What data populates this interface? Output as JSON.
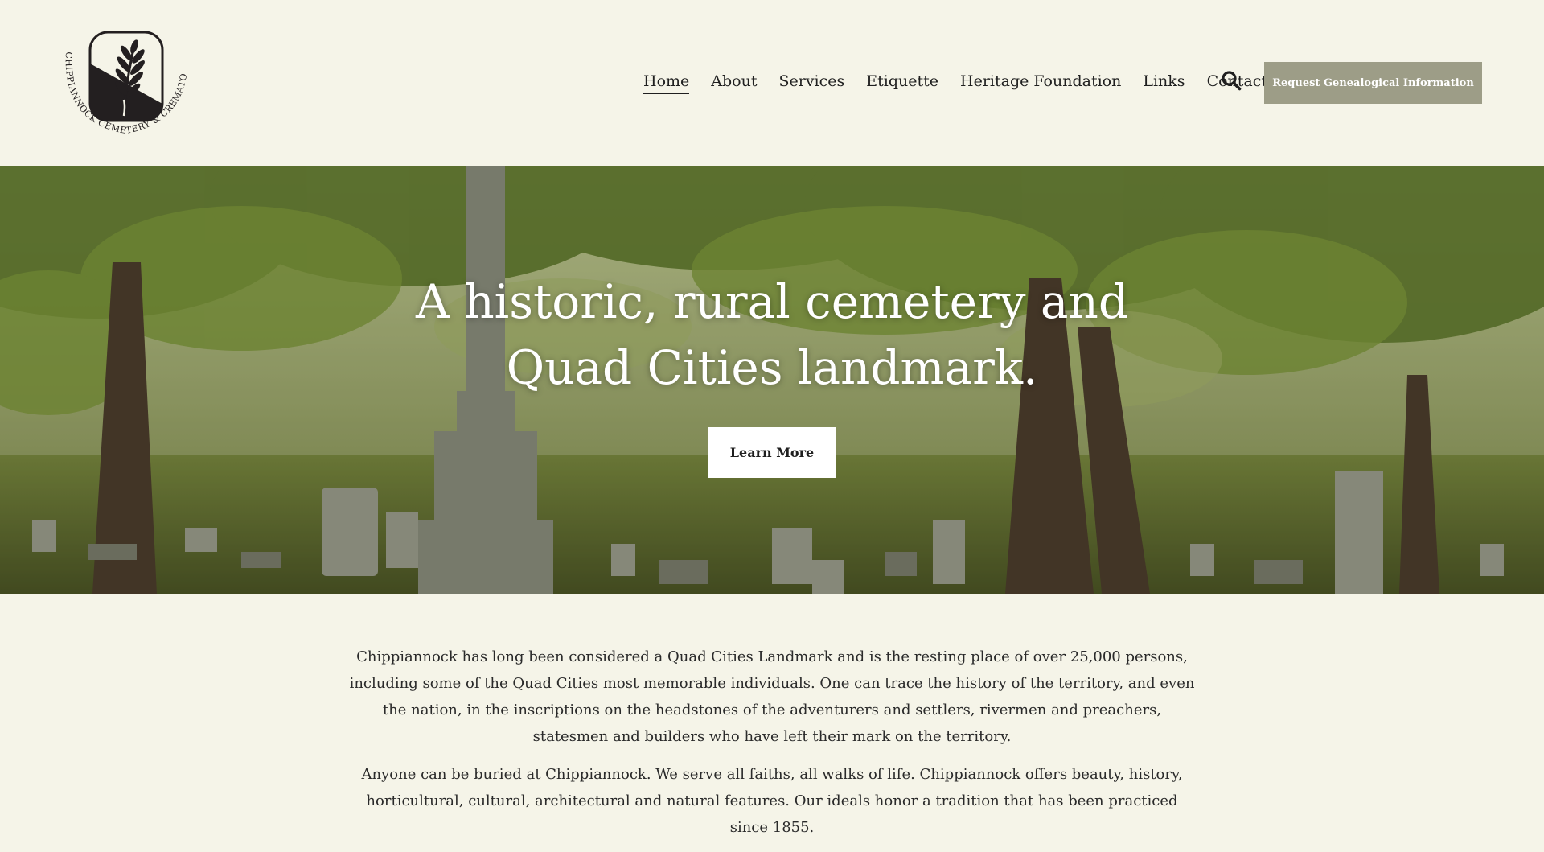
{
  "header": {
    "logo": {
      "arc_text": "CHIPPIANNOCK CEMETERY & CREMATORY"
    },
    "nav": [
      {
        "label": "Home",
        "active": true
      },
      {
        "label": "About"
      },
      {
        "label": "Services"
      },
      {
        "label": "Etiquette"
      },
      {
        "label": "Heritage Foundation"
      },
      {
        "label": "Links"
      },
      {
        "label": "Contact"
      }
    ],
    "search_icon": "search-icon",
    "cta_label": "Request Genealogical Information",
    "cta_color": "#9d9d87"
  },
  "hero": {
    "title": "A historic, rural cemetery and Quad Cities landmark.",
    "button_label": "Learn More"
  },
  "content": {
    "paragraphs": [
      "Chippiannock has long been considered a Quad Cities Landmark and is the resting place of over 25,000 persons, including some of the Quad  Cities most memorable individuals. One can trace the history of the  territory, and even the nation, in the inscriptions on the headstones of  the adventurers and settlers, rivermen and preachers, statesmen and  builders who have left their mark on the territory.",
      "Anyone can be buried at Chippiannock. We serve all faiths, all walks of life. Chippiannock offers beauty, history, horticultural, cultural, architectural and natural features. Our ideals honor a tradition that has been practiced since 1855."
    ]
  },
  "colors": {
    "background": "#f5f4e8",
    "text": "#1f1f1f",
    "hero_overlay": "#1e1e14"
  }
}
